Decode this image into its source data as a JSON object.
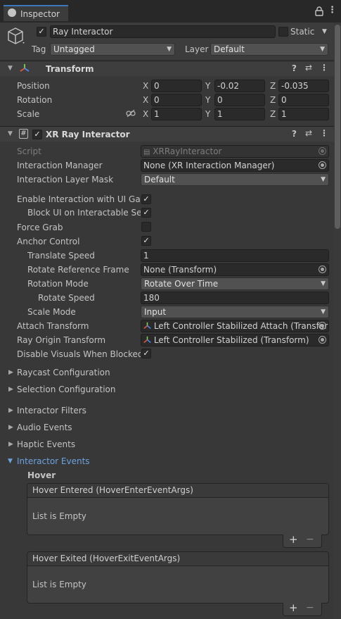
{
  "tab": {
    "title": "Inspector"
  },
  "object": {
    "name": "Ray Interactor",
    "static_label": "Static",
    "tag_label": "Tag",
    "tag_value": "Untagged",
    "layer_label": "Layer",
    "layer_value": "Default"
  },
  "transform": {
    "title": "Transform",
    "position": {
      "label": "Position",
      "x": "0",
      "y": "-0.02",
      "z": "-0.035"
    },
    "rotation": {
      "label": "Rotation",
      "x": "0",
      "y": "0",
      "z": "0"
    },
    "scale": {
      "label": "Scale",
      "x": "1",
      "y": "1",
      "z": "1"
    },
    "axis": {
      "x": "X",
      "y": "Y",
      "z": "Z"
    }
  },
  "xr": {
    "title": "XR Ray Interactor",
    "fields": {
      "script": {
        "label": "Script",
        "value": "XRRayInteractor"
      },
      "interaction_manager": {
        "label": "Interaction Manager",
        "value": "None (XR Interaction Manager)"
      },
      "interaction_layer_mask": {
        "label": "Interaction Layer Mask",
        "value": "Default"
      },
      "enable_ui": {
        "label": "Enable Interaction with UI Game"
      },
      "block_ui": {
        "label": "Block UI on Interactable Sele"
      },
      "force_grab": {
        "label": "Force Grab"
      },
      "anchor_control": {
        "label": "Anchor Control"
      },
      "translate_speed": {
        "label": "Translate Speed",
        "value": "1"
      },
      "rotate_ref": {
        "label": "Rotate Reference Frame",
        "value": "None (Transform)"
      },
      "rotation_mode": {
        "label": "Rotation Mode",
        "value": "Rotate Over Time"
      },
      "rotate_speed": {
        "label": "Rotate Speed",
        "value": "180"
      },
      "scale_mode": {
        "label": "Scale Mode",
        "value": "Input"
      },
      "attach_transform": {
        "label": "Attach Transform",
        "value": "Left Controller Stabilized Attach (Transfor"
      },
      "ray_origin": {
        "label": "Ray Origin Transform",
        "value": "Left Controller Stabilized (Transform)"
      },
      "disable_visuals": {
        "label": "Disable Visuals When Blocked I"
      }
    },
    "foldouts": {
      "raycast": "Raycast Configuration",
      "selection": "Selection Configuration",
      "filters": "Interactor Filters",
      "audio": "Audio Events",
      "haptic": "Haptic Events",
      "interactor_events": "Interactor Events"
    },
    "hover_heading": "Hover",
    "events": [
      {
        "title": "Hover Entered (HoverEnterEventArgs)",
        "empty": "List is Empty"
      },
      {
        "title": "Hover Exited (HoverExitEventArgs)",
        "empty": "List is Empty"
      }
    ]
  },
  "icons": {
    "check": "✓",
    "plus": "+",
    "minus": "−",
    "lock": "🔒",
    "menu": "⋮",
    "help": "?",
    "sliders": "⇄"
  },
  "colors": {
    "accent": "#3a79bb",
    "link": "#6ba3e0"
  }
}
